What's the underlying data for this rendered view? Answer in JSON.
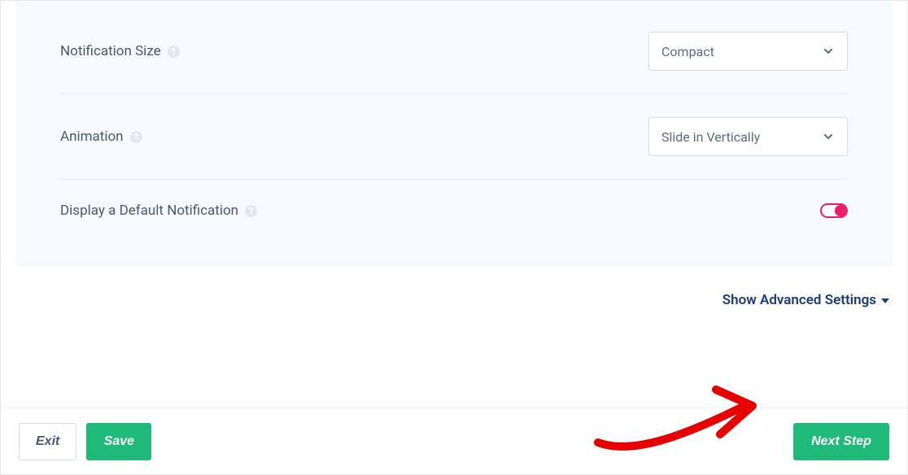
{
  "settings": {
    "notificationSize": {
      "label": "Notification Size",
      "value": "Compact"
    },
    "animation": {
      "label": "Animation",
      "value": "Slide in Vertically"
    },
    "defaultNotification": {
      "label": "Display a Default Notification"
    }
  },
  "advanced": {
    "label": "Show Advanced Settings"
  },
  "footer": {
    "exit": "Exit",
    "save": "Save",
    "next": "Next Step"
  }
}
